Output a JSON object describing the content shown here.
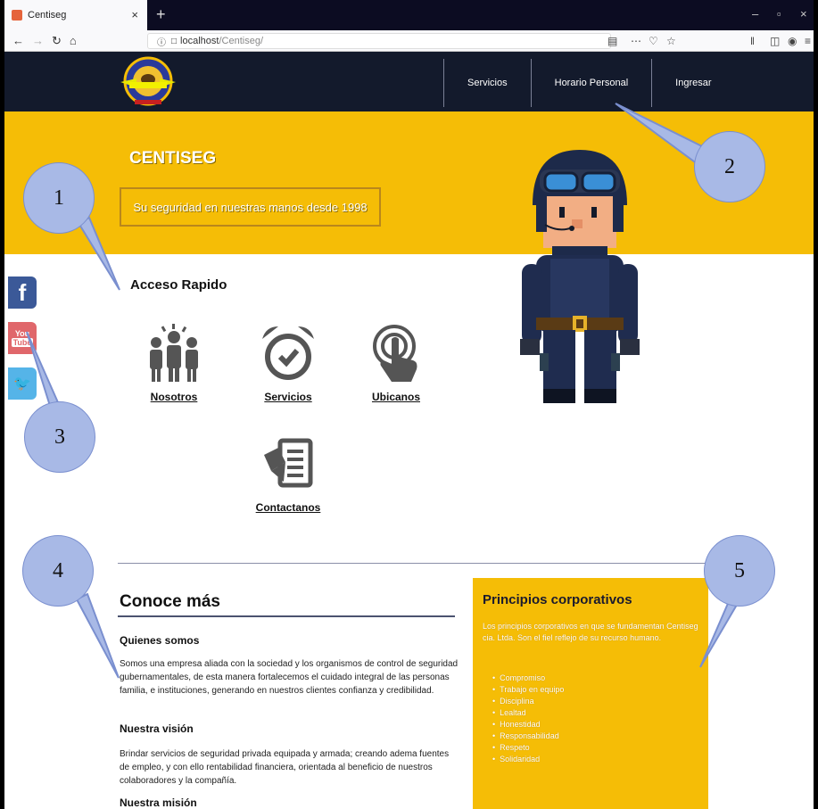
{
  "browser": {
    "tab_title": "Centiseg",
    "tab_close": "×",
    "new_tab": "+",
    "url_host": "localhost",
    "url_path": "/Centiseg/",
    "win_min": "–",
    "win_max": "▫",
    "win_close": "×"
  },
  "nav": {
    "items": [
      "Servicios",
      "Horario Personal",
      "Ingresar"
    ]
  },
  "hero": {
    "title": "CENTISEG",
    "tagline": "Su seguridad en nuestras manos desde 1998"
  },
  "social": {
    "facebook": "f",
    "youtube_top": "You",
    "youtube_bottom": "Tube",
    "twitter": "🐦"
  },
  "quick_access": {
    "title": "Acceso Rapido",
    "items": [
      "Nosotros",
      "Servicios",
      "Ubicanos",
      "Contactanos"
    ]
  },
  "conoce": {
    "title": "Conoce más",
    "quienes_title": "Quienes somos",
    "quienes_text": "Somos una empresa aliada con la sociedad y los organismos de control de seguridad gubernamentales, de esta manera fortalecemos el cuidado integral de las personas familia, e instituciones, generando en nuestros clientes confianza y credibilidad.",
    "vision_title": "Nuestra visión",
    "vision_text": "Brindar servicios de seguridad privada equipada y armada; creando adema fuentes de empleo, y con ello rentabilidad financiera, orientada al beneficio de nuestros colaboradores y la compañía.",
    "mision_title": "Nuestra misión"
  },
  "principios": {
    "title": "Principios corporativos",
    "text": "Los principios corporativos en que se fundamentan Centiseg cia. Ltda. Son el fiel reflejo de su recurso humano.",
    "values": [
      "Compromiso",
      "Trabajo en equipo",
      "Disciplina",
      "Lealtad",
      "Honestidad",
      "Responsabilidad",
      "Respeto",
      "Solidaridad"
    ]
  },
  "callouts": [
    "1",
    "2",
    "3",
    "4",
    "5"
  ],
  "colors": {
    "header_bg": "#131a2c",
    "accent_yellow": "#f5bd06",
    "callout_fill": "#a8b9e6"
  }
}
